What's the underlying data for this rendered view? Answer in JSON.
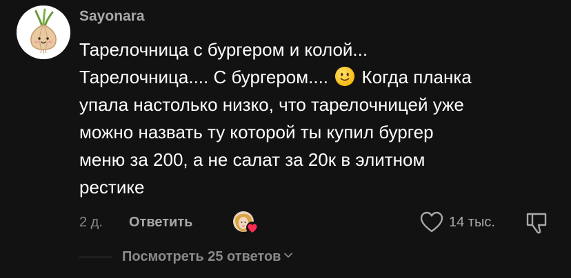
{
  "comment": {
    "username": "Sayonara",
    "text_lines": [
      "Тарелочница с бургером и колой...",
      "Тарелочница.... С бургером....",
      "Когда планка",
      "упала настолько низко, что тарелочницей уже",
      "можно назвать ту которой ты купил бургер",
      "меню за 200, а не салат за 20к в элитном",
      "рестике"
    ],
    "emoji": "slightly-smiling-face-icon",
    "time": "2 д.",
    "reply_label": "Ответить",
    "like_count": "14 тыс.",
    "view_replies_label": "Посмотреть 25 ответов"
  },
  "icons": {
    "avatar": "onion-avatar-icon",
    "creator_liked": "creator-liked-badge-icon",
    "like": "heart-outline-icon",
    "dislike": "dislike-icon",
    "expand": "chevron-down-icon"
  },
  "colors": {
    "background": "#121212",
    "username": "#a8a8a8",
    "text": "#ffffff",
    "secondary": "#8a8a8a",
    "heart_badge": "#fe2c55"
  }
}
